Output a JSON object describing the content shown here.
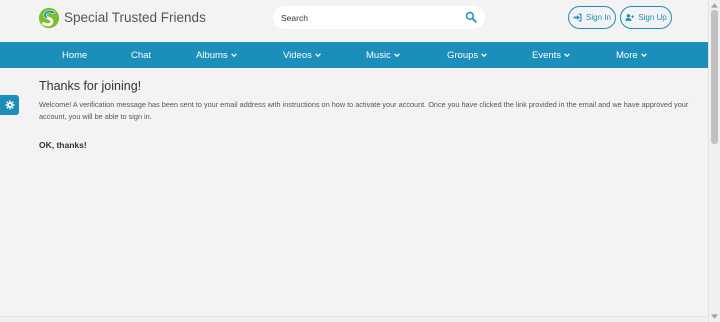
{
  "header": {
    "site_title": "Special Trusted Friends",
    "search_placeholder": "Search",
    "signin_label": "Sign In",
    "signup_label": "Sign Up"
  },
  "nav": {
    "items": [
      {
        "label": "Home"
      },
      {
        "label": "Chat"
      },
      {
        "label": "Albums"
      },
      {
        "label": "Videos"
      },
      {
        "label": "Music"
      },
      {
        "label": "Groups"
      },
      {
        "label": "Events"
      },
      {
        "label": "More"
      }
    ]
  },
  "content": {
    "title": "Thanks for joining!",
    "message": "Welcome! A verification message has been sent to your email address with instructions on how to activate your account. Once you have clicked the link provided in the email and we have approved your account, you will be able to sign in.",
    "ok_label": "OK, thanks!"
  },
  "colors": {
    "accent": "#1b8fb9",
    "background": "#f3f3f3",
    "logo_green": "#7bbf2a",
    "logo_blue": "#1b8fb9"
  },
  "icons": {
    "logo": "swirl-logo-icon",
    "search": "search-icon",
    "signin": "sign-in-icon",
    "signup": "user-plus-icon",
    "dropdown": "caret-down-icon",
    "settings": "gear-icon"
  }
}
